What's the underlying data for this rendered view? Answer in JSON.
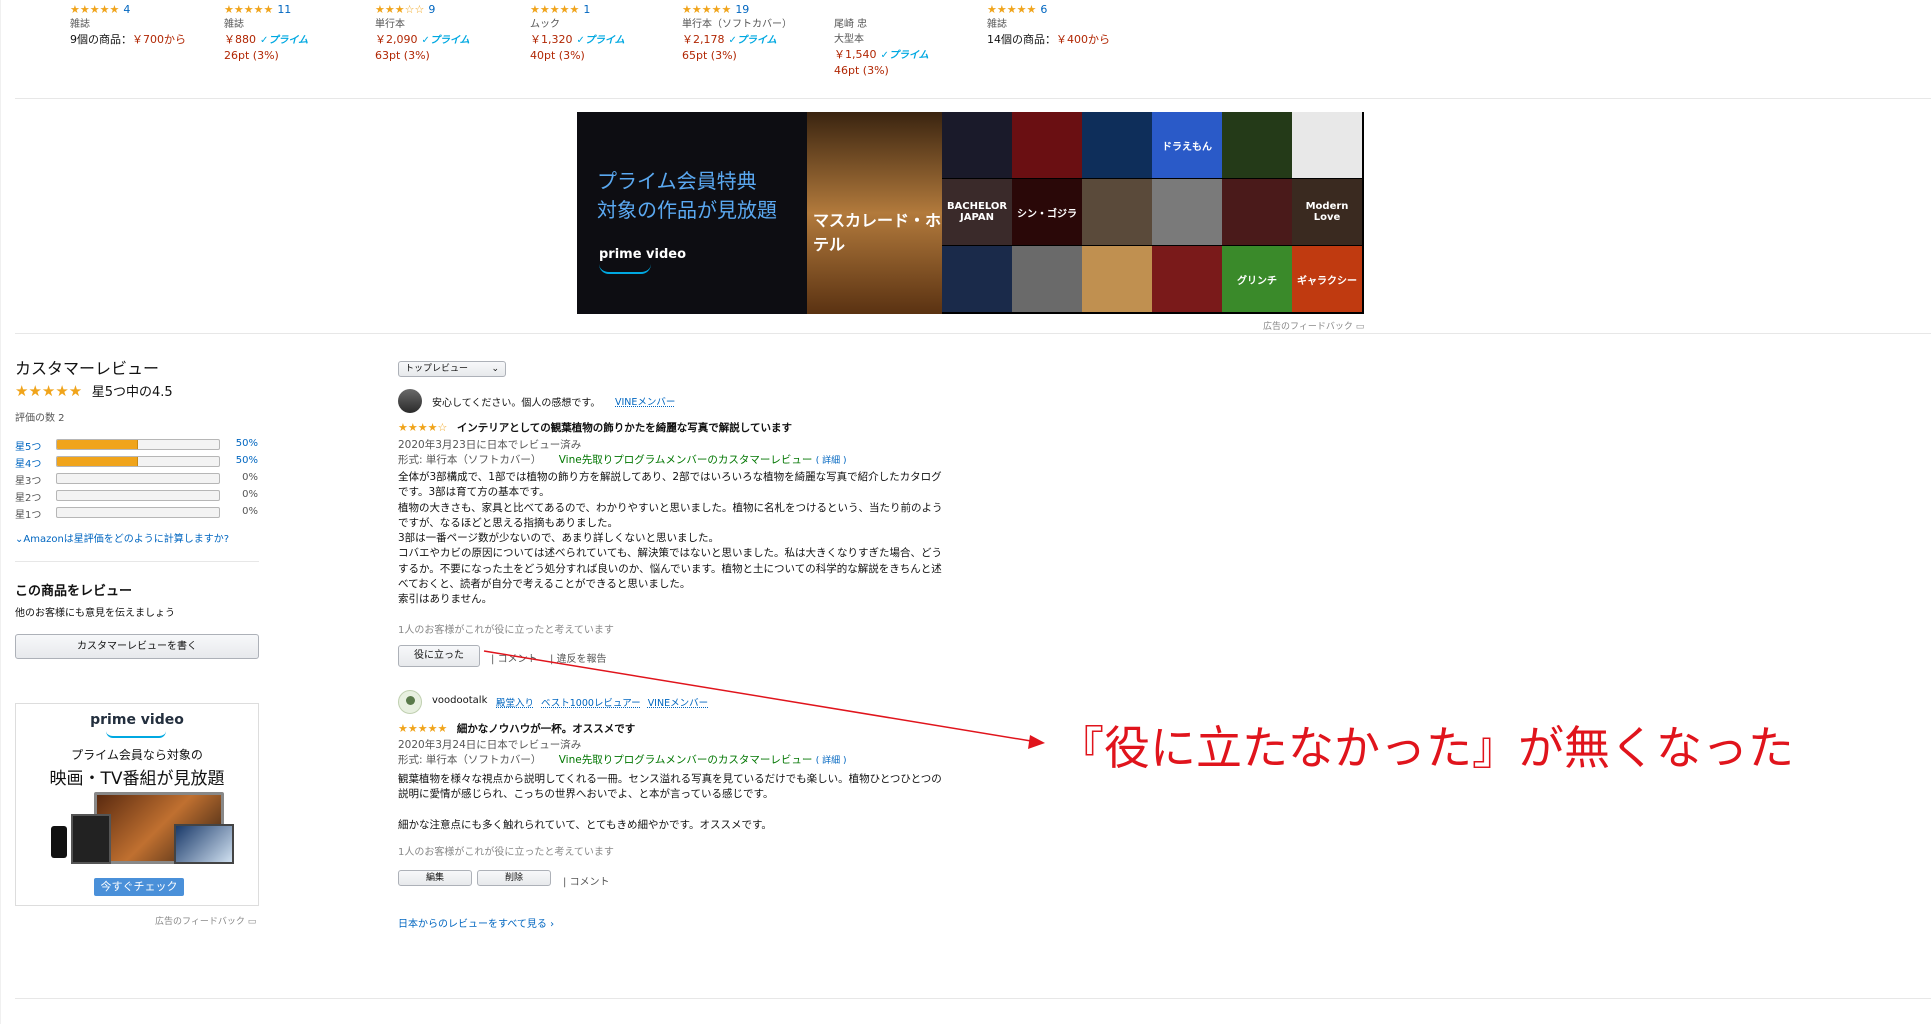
{
  "top_products": [
    {
      "stars": "★★★★★",
      "count": "4",
      "format": "雑誌",
      "price_line": "9個の商品：",
      "price": "￥700から",
      "prime": "",
      "points": ""
    },
    {
      "stars": "★★★★★",
      "count": "11",
      "format": "雑誌",
      "price_line": "",
      "price": "￥880",
      "prime": "✓プライム",
      "points": "26pt (3%)"
    },
    {
      "stars": "★★★☆☆",
      "count": "9",
      "format": "単行本",
      "price_line": "",
      "price": "￥2,090",
      "prime": "✓プライム",
      "points": "63pt (3%)"
    },
    {
      "stars": "★★★★★",
      "count": "1",
      "format": "ムック",
      "price_line": "",
      "price": "￥1,320",
      "prime": "✓プライム",
      "points": "40pt (3%)"
    },
    {
      "stars": "★★★★★",
      "count": "19",
      "format": "単行本（ソフトカバー）",
      "price_line": "",
      "price": "￥2,178",
      "prime": "✓プライム",
      "points": "65pt (3%)"
    },
    {
      "stars": "",
      "count": "",
      "format": "尾崎 忠",
      "format2": "大型本",
      "price_line": "",
      "price": "￥1,540",
      "prime": "✓プライム",
      "points": "46pt (3%)"
    },
    {
      "stars": "★★★★★",
      "count": "6",
      "format": "雑誌",
      "price_line": "14個の商品：",
      "price": "￥400から",
      "prime": "",
      "points": ""
    }
  ],
  "banner": {
    "line1": "プライム会員特典",
    "line2": "対象の作品が見放題",
    "brand": "prime video",
    "poster_title": "マスカレード・ホテル",
    "tiles": [
      "",
      "",
      "",
      "ドラえもん",
      "",
      "",
      "BACHELOR JAPAN",
      "シン・ゴジラ",
      "",
      "",
      "",
      "Modern Love",
      "",
      "",
      "",
      "",
      "グリンチ",
      "ギャラクシー"
    ],
    "feedback": "広告のフィードバック"
  },
  "sidebar": {
    "title": "カスタマーレビュー",
    "stars": "★★★★★",
    "rating_text": "星5つ中の4.5",
    "count_text": "評価の数 2",
    "histogram": [
      {
        "label": "星5つ",
        "pct": "50%",
        "fill": 0.5,
        "link": true
      },
      {
        "label": "星4つ",
        "pct": "50%",
        "fill": 0.5,
        "link": true
      },
      {
        "label": "星3つ",
        "pct": "0%",
        "fill": 0,
        "link": false
      },
      {
        "label": "星2つ",
        "pct": "0%",
        "fill": 0,
        "link": false
      },
      {
        "label": "星1つ",
        "pct": "0%",
        "fill": 0,
        "link": false
      }
    ],
    "calc_link": "Amazonは星評価をどのように計算しますか?",
    "write_title": "この商品をレビュー",
    "write_sub": "他のお客様にも意見を伝えましょう",
    "write_button": "カスタマーレビューを書く",
    "ad_brand": "prime video",
    "ad_line1": "プライム会員なら対象の",
    "ad_line2": "映画・TV番組が見放題",
    "ad_button": "今すぐチェック",
    "ad_feedback": "広告のフィードバック"
  },
  "sort_select": "トップレビュー",
  "reviews": [
    {
      "author": "安心してください。個人の感想です。",
      "badges": [
        "VINEメンバー"
      ],
      "stars": "★★★★☆",
      "title": "インテリアとしての観葉植物の飾りかたを綺麗な写真で解説しています",
      "date": "2020年3月23日に日本でレビュー済み",
      "format": "形式: 単行本（ソフトカバー）",
      "vine": "Vine先取りプログラムメンバーのカスタマーレビュー",
      "detail": "( 詳細 )",
      "body": [
        "全体が3部構成で、1部では植物の飾り方を解説してあり、2部ではいろいろな植物を綺麗な写真で紹介したカタログ",
        "です。3部は育て方の基本です。",
        "植物の大きさも、家具と比べてあるので、わかりやすいと思いました。植物に名札をつけるという、当たり前のよう",
        "ですが、なるほどと思える指摘もありました。",
        "3部は一番ページ数が少ないので、あまり詳しくないと思いました。",
        "コバエやカビの原因については述べられていても、解決策ではないと思いました。私は大きくなりすぎた場合、どう",
        "するか。不要になった土をどう処分すれば良いのか、悩んでいます。植物と土についての科学的な解説をきちんと述",
        "べておくと、読者が自分で考えることができると思いました。",
        "索引はありません。"
      ],
      "helpful": "1人のお客様がこれが役に立ったと考えています",
      "helpful_button": "役に立った",
      "comment": "コメント",
      "report": "違反を報告"
    },
    {
      "author": "voodootalk",
      "badges": [
        "殿堂入り",
        "ベスト1000レビュアー",
        "VINEメンバー"
      ],
      "stars": "★★★★★",
      "title": "細かなノウハウが一杯。オススメです",
      "date": "2020年3月24日に日本でレビュー済み",
      "format": "形式: 単行本（ソフトカバー）",
      "vine": "Vine先取りプログラムメンバーのカスタマーレビュー",
      "detail": "( 詳細 )",
      "body": [
        "観葉植物を様々な視点から説明してくれる一冊。センス溢れる写真を見ているだけでも楽しい。植物ひとつひとつの",
        "説明に愛情が感じられ、こっちの世界へおいでよ、と本が言っている感じです。",
        "",
        "細かな注意点にも多く触れられていて、とてもきめ細やかです。オススメです。"
      ],
      "helpful": "1人のお客様がこれが役に立ったと考えています",
      "edit_button": "編集",
      "delete_button": "削除",
      "comment": "コメント"
    }
  ],
  "all_reviews_link": "日本からのレビューをすべて見る ›",
  "annotation": "『役に立たなかった』が無くなった",
  "colors": {
    "star": "#f0a41b",
    "link": "#0066c0",
    "price": "#b12704",
    "annotation": "#e0141c",
    "vine": "#007600"
  }
}
